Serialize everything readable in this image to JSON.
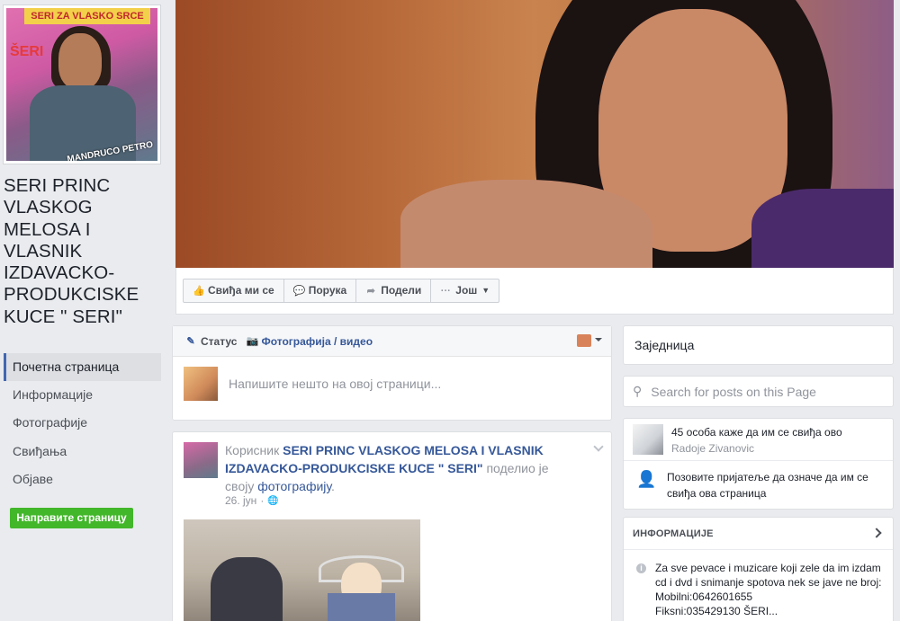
{
  "page": {
    "title": "SERI PRINC VLASKOG MELOSA I VLASNIK IZDAVACKO-PRODUKCISKE KUCE \" SERI\""
  },
  "profile_picture": {
    "top_text": "SERI ZA VLASKO SRCE",
    "side_text": "ŠERI",
    "caption": "MANDRUCO PETRO"
  },
  "nav": {
    "items": [
      "Почетна страница",
      "Информације",
      "Фотографије",
      "Свиђања",
      "Објаве"
    ],
    "create_page": "Направите страницу"
  },
  "actions": {
    "like": "Свиђа ми се",
    "message": "Порука",
    "share": "Подели",
    "more": "Још"
  },
  "composer": {
    "status_tab": "Статус",
    "photo_tab": "Фотографија / видео",
    "placeholder": "Напишите нешто на овој страници..."
  },
  "post": {
    "prefix": "Корисник",
    "author": "SERI PRINC VLASKOG MELOSA I VLASNIK IZDAVACKO-PRODUKCISKE KUCE \" SERI\"",
    "middle": "поделио је свoју",
    "object": "фотографију",
    "suffix": ".",
    "date": "26. јун",
    "sep": "·"
  },
  "sidebar": {
    "community": "Заједница",
    "search_placeholder": "Search for posts on this Page",
    "likes_text": "45 особа каже да им се свиђа ово",
    "likes_sub": "Radoje Zivanovic",
    "invite_text": "Позовите пријатеље да означе да им се свиђа ова страница",
    "info_heading": "ИНФОРМАЦИЈЕ",
    "info_text": [
      "Za sve pevace i muzicare koji zele da im izdam cd i dvd i snimanje spotova nek se jave ne broj:",
      "Mobilni:0642601655",
      "Fiksni:035429130 ŠERI..."
    ]
  },
  "icons": {
    "like": "thumbs-up-icon",
    "message": "messenger-icon",
    "share": "share-arrow-icon",
    "more": "ellipsis-icon",
    "status": "pencil-icon",
    "photo": "camera-icon",
    "search": "search-icon",
    "invite": "add-friend-icon",
    "info": "info-icon"
  }
}
